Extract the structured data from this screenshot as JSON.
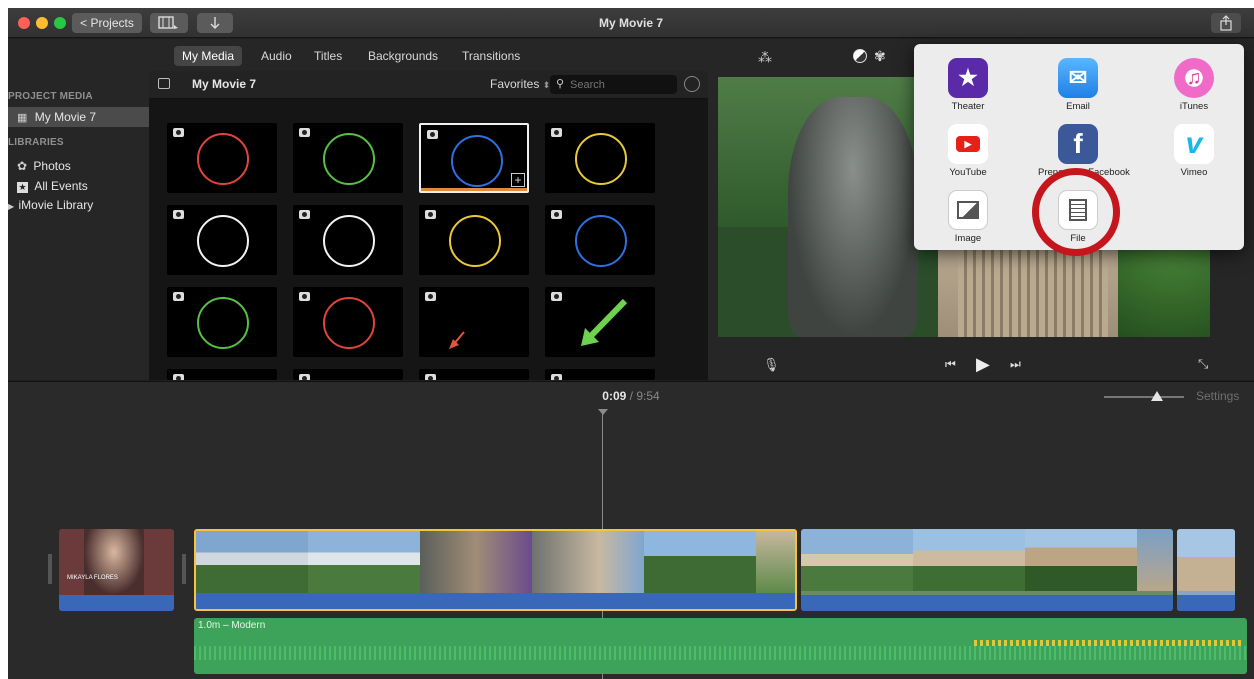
{
  "window": {
    "title": "My Movie 7"
  },
  "toolbar": {
    "projects_label": "< Projects",
    "media_icon": "film-layout-icon",
    "import_icon": "import-arrow-icon",
    "share_icon": "share-icon"
  },
  "tabs": [
    {
      "label": "My Media",
      "active": true
    },
    {
      "label": "Audio"
    },
    {
      "label": "Titles"
    },
    {
      "label": "Backgrounds"
    },
    {
      "label": "Transitions"
    }
  ],
  "sidebar": {
    "project_header": "PROJECT MEDIA",
    "project_item": "My Movie 7",
    "libraries_header": "LIBRARIES",
    "items": [
      {
        "label": "Photos",
        "icon": "photos-icon"
      },
      {
        "label": "All Events",
        "icon": "star-icon"
      },
      {
        "label": "iMovie Library",
        "icon": "disclosure-triangle-icon"
      }
    ]
  },
  "browser": {
    "title": "My Movie 7",
    "filter": "Favorites",
    "search_placeholder": "Search",
    "thumbs": [
      {
        "kind": "ring",
        "color": "#e0453b"
      },
      {
        "kind": "ring",
        "color": "#56c043"
      },
      {
        "kind": "ring",
        "color": "#2f6fe0",
        "selected": true
      },
      {
        "kind": "ring",
        "color": "#e8c93a"
      },
      {
        "kind": "ring",
        "color": "#f2f2f2"
      },
      {
        "kind": "ring",
        "color": "#f2f2f2"
      },
      {
        "kind": "ring",
        "color": "#e8c93a"
      },
      {
        "kind": "ring",
        "color": "#2f6fe0"
      },
      {
        "kind": "ring",
        "color": "#56c043"
      },
      {
        "kind": "ring",
        "color": "#e0453b"
      },
      {
        "kind": "arrow-small",
        "color": "#e2563b"
      },
      {
        "kind": "arrow-big",
        "color": "#6ed24f"
      }
    ]
  },
  "viewer": {
    "tool_icons": [
      "magic-wand-icon",
      "color-balance-icon",
      "color-palette-icon"
    ]
  },
  "share_menu": {
    "items": [
      {
        "label": "Theater",
        "icon": "theater-icon",
        "bg": "#5a2aa8"
      },
      {
        "label": "Email",
        "icon": "email-icon",
        "bg": "#3a9af0"
      },
      {
        "label": "iTunes",
        "icon": "itunes-icon",
        "bg": "#f06ac8"
      },
      {
        "label": "YouTube",
        "icon": "youtube-icon",
        "bg": "#ffffff"
      },
      {
        "label": "Prepare for Facebook",
        "icon": "facebook-icon",
        "bg": "#3b5998"
      },
      {
        "label": "Vimeo",
        "icon": "vimeo-icon",
        "bg": "#ffffff"
      },
      {
        "label": "Image",
        "icon": "image-icon",
        "bg": "#ffffff"
      },
      {
        "label": "File",
        "icon": "file-film-icon",
        "bg": "#ffffff",
        "highlighted": true
      }
    ]
  },
  "timeline": {
    "current_time": "0:09",
    "total_time": "9:54",
    "settings_label": "Settings",
    "title_clip_text": "MIKAYLA FLORES",
    "audio_label": "1.0m – Modern"
  },
  "colors": {
    "accent": "#f5c242",
    "audio_track": "#3ea35a",
    "highlight_circle": "#c4161c"
  }
}
